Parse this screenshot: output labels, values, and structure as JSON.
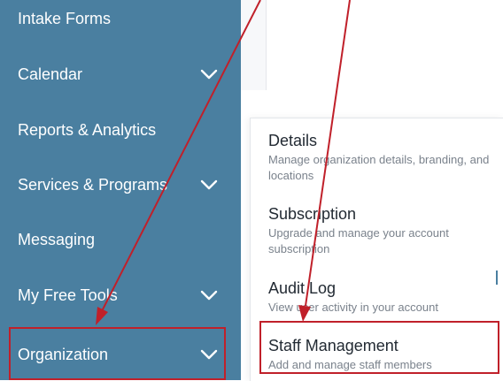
{
  "sidebar": {
    "items": [
      {
        "label": "Intake Forms",
        "has_chevron": false
      },
      {
        "label": "Calendar",
        "has_chevron": true
      },
      {
        "label": "Reports & Analytics",
        "has_chevron": false
      },
      {
        "label": "Services & Programs",
        "has_chevron": true
      },
      {
        "label": "Messaging",
        "has_chevron": false
      },
      {
        "label": "My Free Tools",
        "has_chevron": true
      },
      {
        "label": "Organization",
        "has_chevron": true
      }
    ]
  },
  "organization_menu": {
    "items": [
      {
        "title": "Details",
        "description": "Manage organization details, branding, and locations"
      },
      {
        "title": "Subscription",
        "description": "Upgrade and manage your account subscription"
      },
      {
        "title": "Audit Log",
        "description": "View user activity in your account"
      },
      {
        "title": "Staff Management",
        "description": "Add and manage staff members"
      }
    ]
  },
  "colors": {
    "sidebar_bg": "#4a7fa0",
    "annotation_red": "#c0202a",
    "title_text": "#222a33",
    "description_text": "#7a828c"
  }
}
